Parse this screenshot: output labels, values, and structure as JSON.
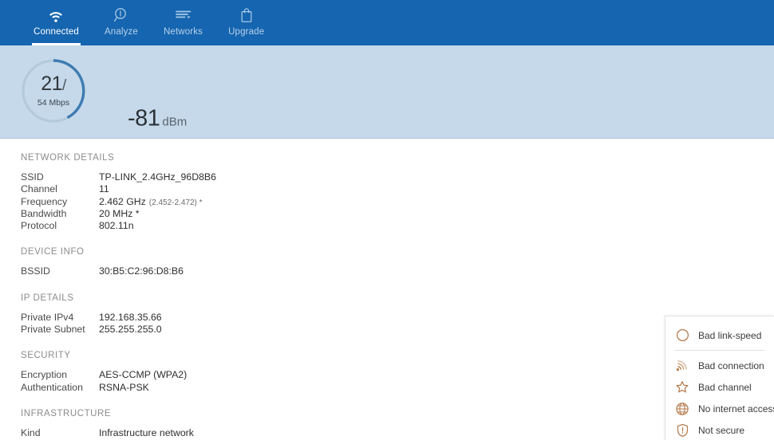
{
  "colors": {
    "nav_blue": "#1565b0",
    "panel_blue": "#c6d9ea",
    "signal_brown": "#9c5a24",
    "marker_brown": "#b06a2a",
    "gauge_arc_blue": "#3e7cb1",
    "gauge_track": "#b3cadb",
    "legend_icon": "#b5794a"
  },
  "nav": {
    "tabs": [
      {
        "label": "Connected",
        "icon": "wifi-icon",
        "active": true
      },
      {
        "label": "Analyze",
        "icon": "magnifier-icon",
        "active": false
      },
      {
        "label": "Networks",
        "icon": "networks-lines-icon",
        "active": false
      },
      {
        "label": "Upgrade",
        "icon": "shopping-bag-icon",
        "active": false
      }
    ]
  },
  "signal": {
    "gauge": {
      "value": "21",
      "slash": "/",
      "subtitle": "54 Mbps",
      "percent": 21
    },
    "dbm": {
      "value": "-81",
      "unit": "dBm"
    },
    "bar": {
      "fill_percent": 21
    },
    "status_icons": [
      {
        "name": "bad-connection-icon",
        "state": "warning"
      },
      {
        "name": "bad-channel-star-icon",
        "state": "normal"
      },
      {
        "name": "no-internet-globe-icon",
        "state": "normal"
      },
      {
        "name": "not-secure-shield-icon",
        "state": "normal"
      }
    ]
  },
  "details": {
    "sections": [
      {
        "title": "NETWORK DETAILS",
        "rows": [
          {
            "label": "SSID",
            "value": "TP-LINK_2.4GHz_96D8B6",
            "sub": ""
          },
          {
            "label": "Channel",
            "value": "11",
            "sub": ""
          },
          {
            "label": "Frequency",
            "value": "2.462 GHz",
            "sub": "(2.452-2.472) *"
          },
          {
            "label": "Bandwidth",
            "value": "20 MHz *",
            "sub": ""
          },
          {
            "label": "Protocol",
            "value": "802.11n",
            "sub": ""
          }
        ]
      },
      {
        "title": "DEVICE INFO",
        "rows": [
          {
            "label": "BSSID",
            "value": "30:B5:C2:96:D8:B6",
            "sub": ""
          }
        ]
      },
      {
        "title": "IP DETAILS",
        "rows": [
          {
            "label": "Private IPv4",
            "value": "192.168.35.66",
            "sub": ""
          },
          {
            "label": "Private Subnet",
            "value": "255.255.255.0",
            "sub": ""
          }
        ]
      },
      {
        "title": "SECURITY",
        "rows": [
          {
            "label": "Encryption",
            "value": "AES-CCMP (WPA2)",
            "sub": ""
          },
          {
            "label": "Authentication",
            "value": "RSNA-PSK",
            "sub": ""
          }
        ]
      },
      {
        "title": "INFRASTRUCTURE",
        "rows": [
          {
            "label": "Kind",
            "value": "Infrastructure network",
            "sub": ""
          }
        ]
      }
    ]
  },
  "legend": {
    "items": [
      {
        "label": "Bad link-speed",
        "icon": "circle-icon"
      },
      {
        "label": "Bad connection",
        "icon": "wifi-arc-icon"
      },
      {
        "label": "Bad channel",
        "icon": "star-icon"
      },
      {
        "label": "No internet access",
        "icon": "globe-icon"
      },
      {
        "label": "Not secure",
        "icon": "shield-icon"
      }
    ]
  }
}
